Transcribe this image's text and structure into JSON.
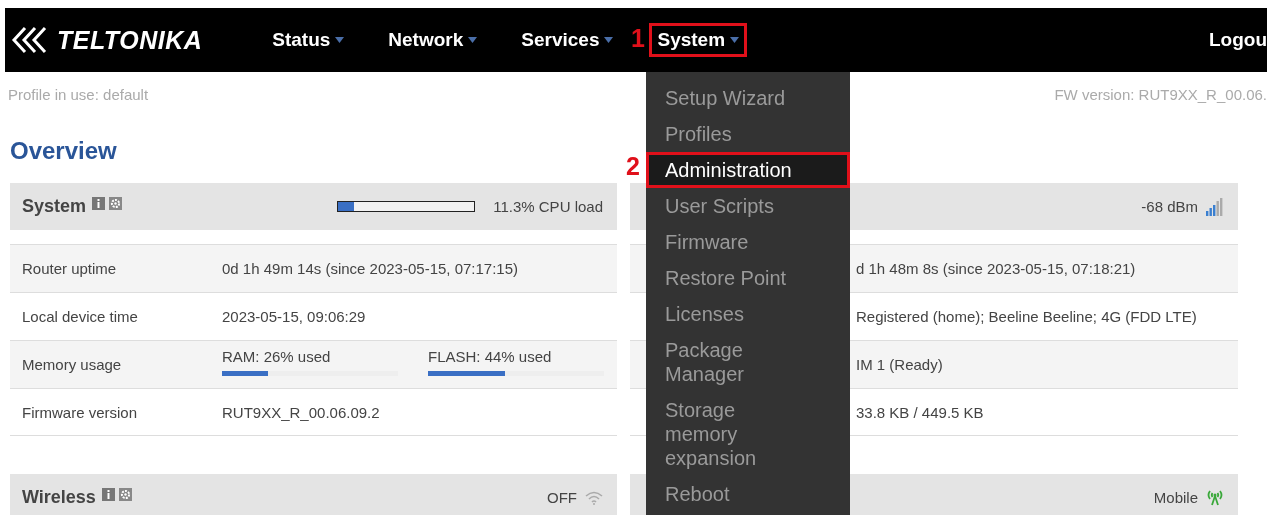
{
  "nav": {
    "logo": "TELTONIKA",
    "items": [
      {
        "label": "Status",
        "selected": false
      },
      {
        "label": "Network",
        "selected": false
      },
      {
        "label": "Services",
        "selected": false
      },
      {
        "label": "System",
        "selected": true
      }
    ],
    "logout": "Logou"
  },
  "annotations": [
    "1",
    "2"
  ],
  "profile": "Profile in use: default",
  "fw_version": "FW version: RUT9XX_R_00.06.",
  "title": "Overview",
  "dropdown": {
    "items": [
      {
        "label": "Setup Wizard",
        "selected": false
      },
      {
        "label": "Profiles",
        "selected": false
      },
      {
        "label": "Administration",
        "selected": true
      },
      {
        "label": "User Scripts",
        "selected": false
      },
      {
        "label": "Firmware",
        "selected": false
      },
      {
        "label": "Restore Point",
        "selected": false
      },
      {
        "label": "Licenses",
        "selected": false
      },
      {
        "label": "Package Manager",
        "selected": false
      },
      {
        "label": "Storage memory expansion",
        "selected": false
      },
      {
        "label": "Reboot",
        "selected": false
      }
    ]
  },
  "system_panel": {
    "title": "System",
    "cpu": {
      "level": 0.113,
      "reading": "11.3% CPU load"
    },
    "rows": [
      {
        "kind": "text",
        "label": "Router uptime",
        "value": "0d 1h 49m 14s (since 2023-05-15, 07:17:15)"
      },
      {
        "kind": "text",
        "label": "Local device time",
        "value": "2023-05-15, 09:06:29"
      },
      {
        "kind": "memory",
        "label": "Memory usage",
        "meters": [
          {
            "label": "RAM: 26% used",
            "level": 0.26
          },
          {
            "label": "FLASH: 44% used",
            "level": 0.44
          }
        ]
      },
      {
        "kind": "text",
        "label": "Firmware version",
        "value": "RUT9XX_R_00.06.09.2"
      }
    ]
  },
  "mobile_panel": {
    "reading": "-68 dBm",
    "rows": [
      "d 1h 48m 8s (since 2023-05-15, 07:18:21)",
      "Registered (home); Beeline Beeline; 4G (FDD LTE)",
      "IM 1 (Ready)",
      "33.8 KB / 449.5 KB"
    ]
  },
  "wireless_panel": {
    "title": "Wireless",
    "status": "OFF"
  },
  "wan_panel": {
    "status": "Mobile"
  }
}
